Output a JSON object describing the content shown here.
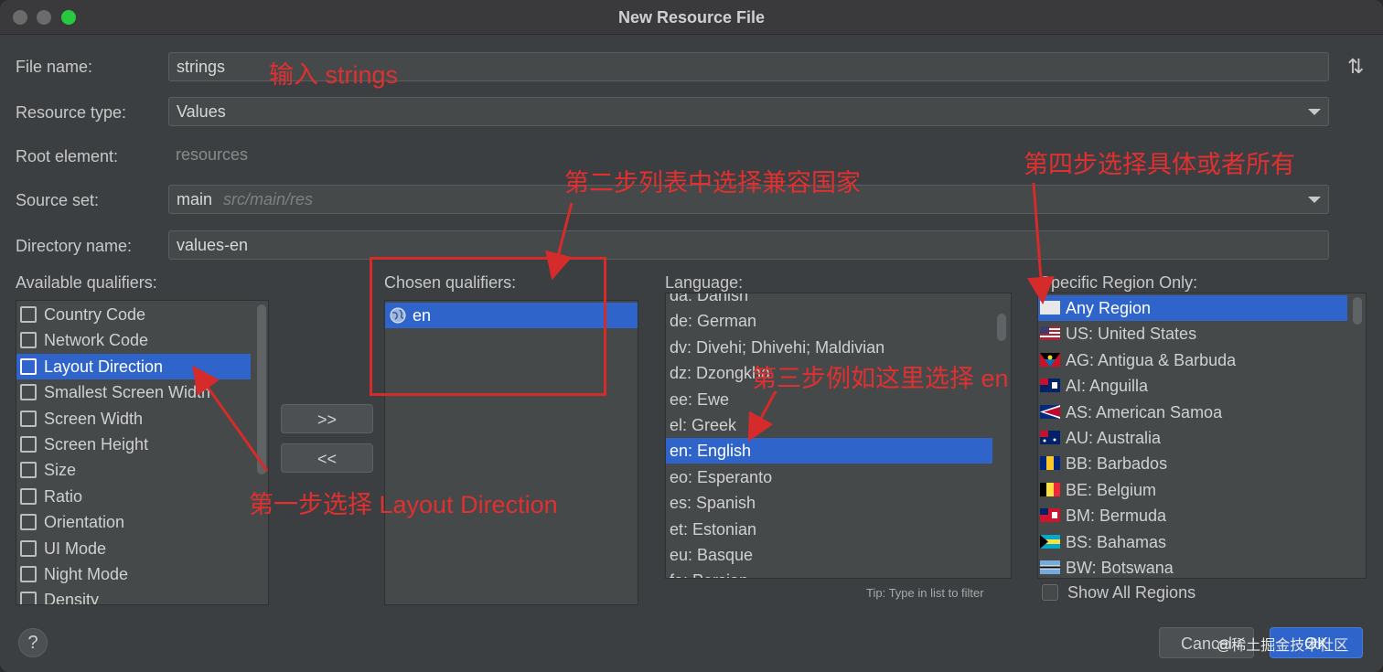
{
  "window": {
    "title": "New Resource File"
  },
  "form": {
    "file_name_label": "File name:",
    "file_name_value": "strings",
    "resource_type_label": "Resource type:",
    "resource_type_value": "Values",
    "root_element_label": "Root element:",
    "root_element_value": "resources",
    "source_set_label": "Source set:",
    "source_set_value": "main",
    "source_set_path": "src/main/res",
    "directory_name_label": "Directory name:",
    "directory_name_value": "values-en"
  },
  "qualifiers": {
    "available_label": "Available qualifiers:",
    "available": [
      {
        "label": "Country Code",
        "icon": "country-code-icon"
      },
      {
        "label": "Network Code",
        "icon": "network-code-icon"
      },
      {
        "label": "Layout Direction",
        "icon": "layout-direction-icon",
        "selected": true
      },
      {
        "label": "Smallest Screen Width",
        "icon": "smallest-width-icon"
      },
      {
        "label": "Screen Width",
        "icon": "screen-width-icon"
      },
      {
        "label": "Screen Height",
        "icon": "screen-height-icon"
      },
      {
        "label": "Size",
        "icon": "size-icon"
      },
      {
        "label": "Ratio",
        "icon": "ratio-icon"
      },
      {
        "label": "Orientation",
        "icon": "orientation-icon"
      },
      {
        "label": "UI Mode",
        "icon": "ui-mode-icon"
      },
      {
        "label": "Night Mode",
        "icon": "night-mode-icon"
      },
      {
        "label": "Density",
        "icon": "density-icon"
      }
    ],
    "add_button": ">>",
    "remove_button": "<<",
    "chosen_label": "Chosen qualifiers:",
    "chosen": [
      {
        "label": "en",
        "icon": "globe-icon"
      }
    ]
  },
  "language": {
    "label": "Language:",
    "items": [
      "da: Danish",
      "de: German",
      "dv: Divehi; Dhivehi; Maldivian",
      "dz: Dzongkha",
      "ee: Ewe",
      "el: Greek",
      "en: English",
      "eo: Esperanto",
      "es: Spanish",
      "et: Estonian",
      "eu: Basque",
      "fa: Persian"
    ],
    "selected": "en: English",
    "tip": "Tip: Type in list to filter"
  },
  "region": {
    "label": "Specific Region Only:",
    "items": [
      {
        "label": "Any Region",
        "flag": "blank"
      },
      {
        "label": "US: United States",
        "flag": "us"
      },
      {
        "label": "AG: Antigua & Barbuda",
        "flag": "ag"
      },
      {
        "label": "AI: Anguilla",
        "flag": "ai"
      },
      {
        "label": "AS: American Samoa",
        "flag": "as"
      },
      {
        "label": "AU: Australia",
        "flag": "au"
      },
      {
        "label": "BB: Barbados",
        "flag": "bb"
      },
      {
        "label": "BE: Belgium",
        "flag": "be"
      },
      {
        "label": "BM: Bermuda",
        "flag": "bm"
      },
      {
        "label": "BS: Bahamas",
        "flag": "bs"
      },
      {
        "label": "BW: Botswana",
        "flag": "bw"
      }
    ],
    "selected": "Any Region",
    "show_all_label": "Show All Regions"
  },
  "buttons": {
    "help": "?",
    "cancel": "Cancel",
    "ok": "OK"
  },
  "annotations": {
    "input_strings": "输入 strings",
    "step1": "第一步选择 Layout Direction",
    "step2": "第二步列表中选择兼容国家",
    "step3": "第三步例如这里选择 en",
    "step4": "第四步选择具体或者所有"
  },
  "watermark": "@稀土掘金技术社区",
  "colors": {
    "selection": "#2f65ca",
    "annotation": "#d62b2b",
    "background": "#3c3f41"
  }
}
